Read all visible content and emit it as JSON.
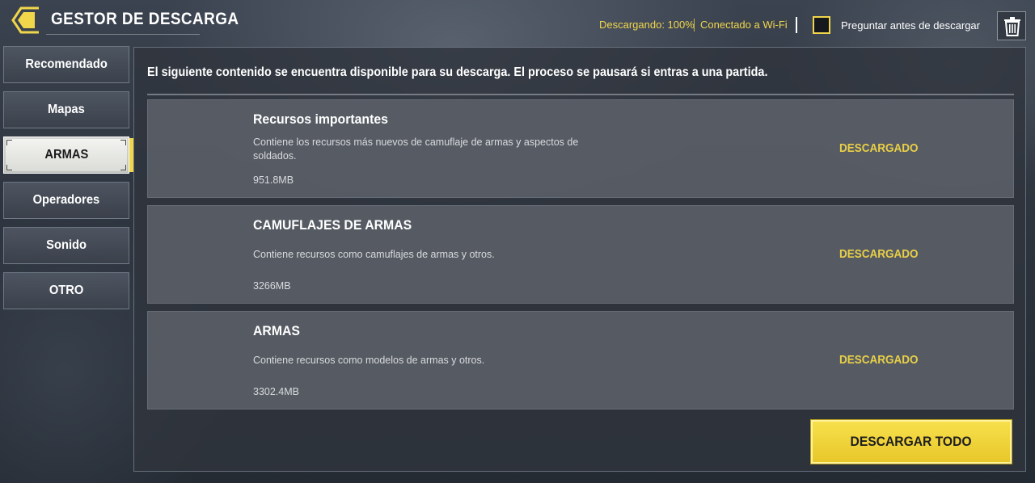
{
  "header": {
    "title": "GESTOR DE DESCARGA",
    "download_status": "Descargando: 100%",
    "connection_status": "Conectado a Wi-Fi",
    "ask_before_download_label": "Preguntar antes de descargar",
    "ask_before_download_checked": false
  },
  "sidebar": {
    "items": [
      {
        "label": "Recomendado",
        "active": false
      },
      {
        "label": "Mapas",
        "active": false
      },
      {
        "label": "ARMAS",
        "active": true
      },
      {
        "label": "Operadores",
        "active": false
      },
      {
        "label": "Sonido",
        "active": false
      },
      {
        "label": "OTRO",
        "active": false
      }
    ]
  },
  "main": {
    "intro": "El siguiente contenido se encuentra disponible para su descarga. El proceso se pausará si entras a una partida.",
    "cards": [
      {
        "title": "Recursos importantes",
        "description": "Contiene los recursos más nuevos de camuflaje de armas y aspectos de soldados.",
        "size": "951.8MB",
        "status": "DESCARGADO"
      },
      {
        "title": "CAMUFLAJES DE ARMAS",
        "description": "Contiene recursos como camuflajes de armas y otros.",
        "size": "3266MB",
        "status": "DESCARGADO"
      },
      {
        "title": "ARMAS",
        "description": "Contiene recursos como modelos de armas y otros.",
        "size": "3302.4MB",
        "status": "DESCARGADO"
      }
    ],
    "download_all_label": "DESCARGAR TODO"
  },
  "icons": {
    "back": "back-arrow-icon",
    "trash": "trash-icon"
  },
  "colors": {
    "accent": "#f1d64b",
    "status_text": "#e8cf48"
  }
}
